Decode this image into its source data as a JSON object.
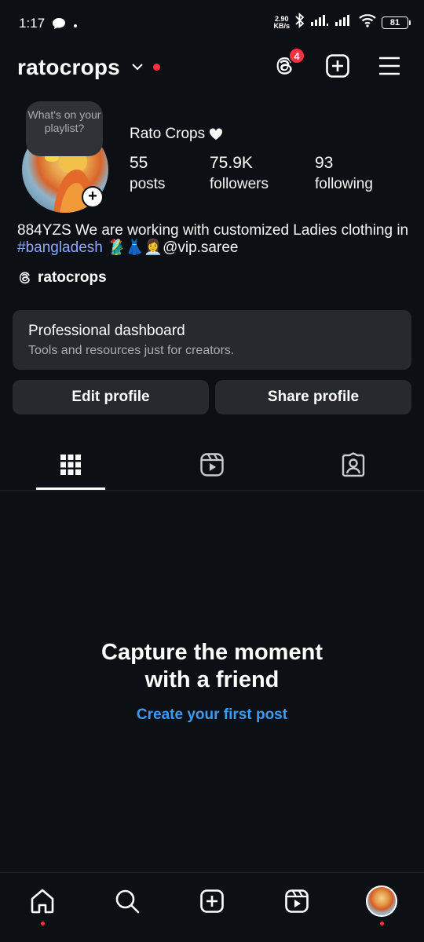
{
  "status_bar": {
    "time": "1:17",
    "net_speed_value": "2.90",
    "net_speed_unit": "KB/s",
    "battery": "81"
  },
  "header": {
    "username": "ratocrops",
    "threads_badge_count": "4"
  },
  "profile": {
    "note_text": "What's on your playlist?",
    "display_name": "Rato Crops",
    "stats": [
      {
        "value": "55",
        "label": "posts"
      },
      {
        "value": "75.9K",
        "label": "followers"
      },
      {
        "value": "93",
        "label": "following"
      }
    ],
    "bio_text_1": "884YZS We are working with customized Ladies clothing in ",
    "bio_hashtag": "#bangladesh",
    "bio_text_2": " 🥻👗👩‍💼@vip.saree",
    "threads_handle": "ratocrops"
  },
  "dashboard": {
    "title": "Professional dashboard",
    "subtitle": "Tools and resources just for creators."
  },
  "buttons": {
    "edit_profile": "Edit profile",
    "share_profile": "Share profile"
  },
  "empty_state": {
    "title_line1": "Capture the moment",
    "title_line2": "with a friend",
    "link": "Create your first post"
  },
  "colors": {
    "background": "#0c1014",
    "card": "#262a2f",
    "notification_red": "#ff3040",
    "link_blue": "#3a9cf4",
    "hashtag": "#8fa7ff"
  }
}
